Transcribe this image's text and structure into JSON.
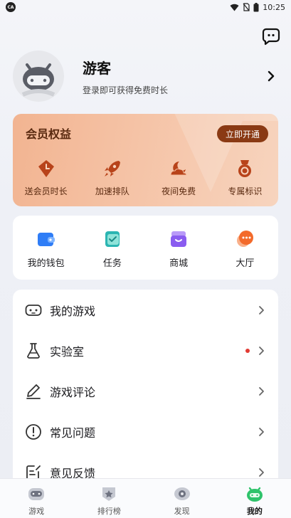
{
  "status_bar": {
    "time": "10:25",
    "app_badge": "CA"
  },
  "profile": {
    "name": "游客",
    "hint": "登录即可获得免费时长"
  },
  "vip": {
    "title": "会员权益",
    "open_button": "立即开通",
    "items": [
      {
        "label": "送会员时长",
        "icon": "gift-tag-icon"
      },
      {
        "label": "加速排队",
        "icon": "rocket-icon"
      },
      {
        "label": "夜间免费",
        "icon": "moon-cloud-icon"
      },
      {
        "label": "专属标识",
        "icon": "medal-icon"
      }
    ]
  },
  "quick": {
    "items": [
      {
        "label": "我的钱包",
        "icon": "wallet-icon",
        "color": "#2f7df6"
      },
      {
        "label": "任务",
        "icon": "task-icon",
        "color": "#2bb5b2"
      },
      {
        "label": "商城",
        "icon": "shop-icon",
        "color": "#8a5cf0"
      },
      {
        "label": "大厅",
        "icon": "lobby-icon",
        "color": "#f36a2b"
      }
    ]
  },
  "menu": {
    "items": [
      {
        "label": "我的游戏",
        "icon": "gamepad-icon",
        "dot": false
      },
      {
        "label": "实验室",
        "icon": "flask-icon",
        "dot": true
      },
      {
        "label": "游戏评论",
        "icon": "pen-icon",
        "dot": false
      },
      {
        "label": "常见问题",
        "icon": "alert-circle-icon",
        "dot": false
      },
      {
        "label": "意见反馈",
        "icon": "feedback-icon",
        "dot": false
      }
    ]
  },
  "bottom_nav": {
    "items": [
      {
        "label": "游戏",
        "icon": "game-tab-icon"
      },
      {
        "label": "排行榜",
        "icon": "rank-tab-icon"
      },
      {
        "label": "发现",
        "icon": "discover-tab-icon"
      },
      {
        "label": "我的",
        "icon": "me-tab-icon",
        "active": true
      }
    ]
  },
  "colors": {
    "accent": "#2fc36b",
    "vip_button": "#8a3a14",
    "dot": "#e23a33"
  }
}
